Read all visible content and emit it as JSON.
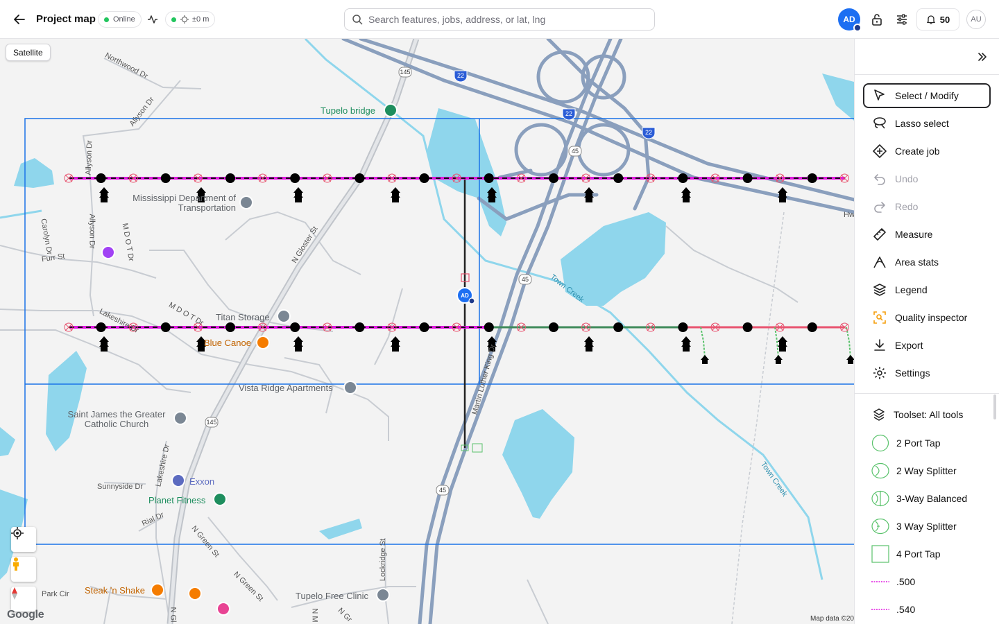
{
  "header": {
    "title": "Project map",
    "status_label": "Online",
    "accuracy_label": "±0 m",
    "search_placeholder": "Search features, jobs, address, or lat, lng",
    "user_initials": "AD",
    "notification_count": "50",
    "secondary_user_initials": "AU",
    "colors": {
      "online": "#22c55e",
      "accent": "#1d6ff2"
    }
  },
  "map": {
    "satellite_button": "Satellite",
    "pois": {
      "tupelo_bridge": "Tupelo bridge",
      "mdot": "Mississippi Department of Transportation",
      "titan_storage": "Titan Storage",
      "blue_canoe": "Blue Canoe",
      "vista_ridge": "Vista Ridge Apartments",
      "saint_james": "Saint James the Greater Catholic Church",
      "exxon": "Exxon",
      "planet_fitness": "Planet Fitness",
      "steak_n_shake": "Steak 'n Shake",
      "tupelo_clinic": "Tupelo Free Clinic"
    },
    "roads": {
      "northwood": "Northwood Dr",
      "allyson": "Allyson Dr",
      "carolyn": "Carolyn Dr",
      "mdot_dr": "M D O T Dr",
      "furr": "Furr St",
      "lakeshire": "Lakeshire Dr",
      "n_gloster": "N Gloster St",
      "mlk": "Martin Luther King Dr",
      "town_creek": "Town Creek",
      "sunnyside": "Sunnyside Dr",
      "rial": "Rial Dr",
      "n_green": "N Green St",
      "lockridge": "Lockridge St",
      "park_cir": "Park Cir",
      "hw": "Hw",
      "n_gl": "N Gl",
      "n_m": "N M",
      "n_gr": "N Gr",
      "shield_145": "145",
      "shield_22": "22",
      "shield_45": "45"
    },
    "avatar_marker": "AD",
    "attribution": "Map data ©20",
    "google": "Google"
  },
  "tools": {
    "select": "Select / Modify",
    "lasso": "Lasso select",
    "create_job": "Create job",
    "undo": "Undo",
    "redo": "Redo",
    "measure": "Measure",
    "area_stats": "Area stats",
    "legend": "Legend",
    "quality": "Quality inspector",
    "export": "Export",
    "settings": "Settings"
  },
  "toolset": {
    "title": "Toolset: All tools",
    "items": [
      "2 Port Tap",
      "2 Way Splitter",
      "3-Way Balanced",
      "3 Way Splitter",
      "4 Port Tap",
      ".500",
      ".540"
    ]
  },
  "colors": {
    "cable_magenta": "#e11ae0",
    "cable_green": "#3f8a5a",
    "cable_red": "#e8536f",
    "grid_blue": "#1a73e8",
    "water": "#8fd6ec",
    "highway": "#8a9fbd"
  }
}
